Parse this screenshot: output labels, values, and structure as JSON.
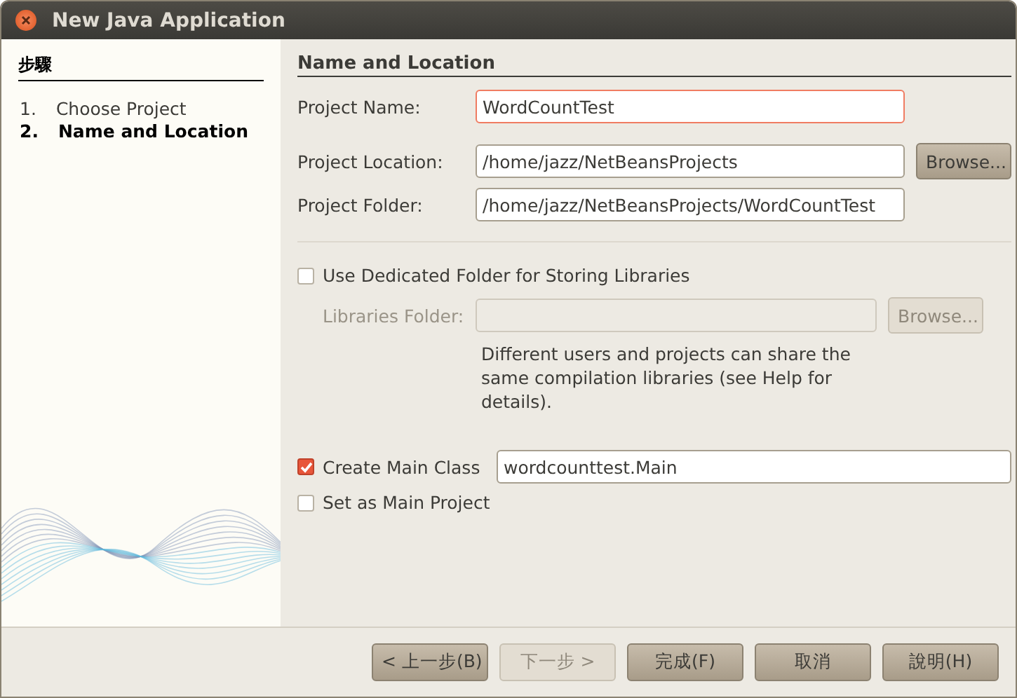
{
  "window": {
    "title": "New Java Application"
  },
  "steps": {
    "heading": "步驟",
    "items": [
      {
        "number": "1.",
        "label": "Choose Project",
        "selected": false
      },
      {
        "number": "2.",
        "label": "Name and Location",
        "selected": true
      }
    ]
  },
  "section_title": "Name and Location",
  "fields": [
    {
      "label": "Project Name:",
      "value": "WordCountTest",
      "focused": true
    },
    {
      "label": "Project Location:",
      "value": "/home/jazz/NetBeansProjects",
      "focused": false,
      "button": "Browse..."
    },
    {
      "label": "Project Folder:",
      "value": "/home/jazz/NetBeansProjects/WordCountTest",
      "focused": false
    }
  ],
  "libraries": {
    "label": "Use Dedicated Folder for Storing Libraries",
    "checked": false,
    "folder_label": "Libraries Folder:",
    "disabled": true,
    "button": "Browse...",
    "note": "Different users and projects can share the same compilation libraries (see Help for details)."
  },
  "main_class": {
    "label": "Create Main Class",
    "checked": true,
    "value": "wordcounttest.Main"
  },
  "main_project": {
    "label": "Set as Main Project",
    "checked": false
  },
  "buttons": [
    {
      "label": "< 上一步(B)",
      "disabled": false
    },
    {
      "label": "下一步 >",
      "disabled": true
    },
    {
      "label": "完成(F)",
      "disabled": false
    },
    {
      "label": "取消",
      "disabled": false
    },
    {
      "label": "說明(H)",
      "disabled": false
    }
  ]
}
